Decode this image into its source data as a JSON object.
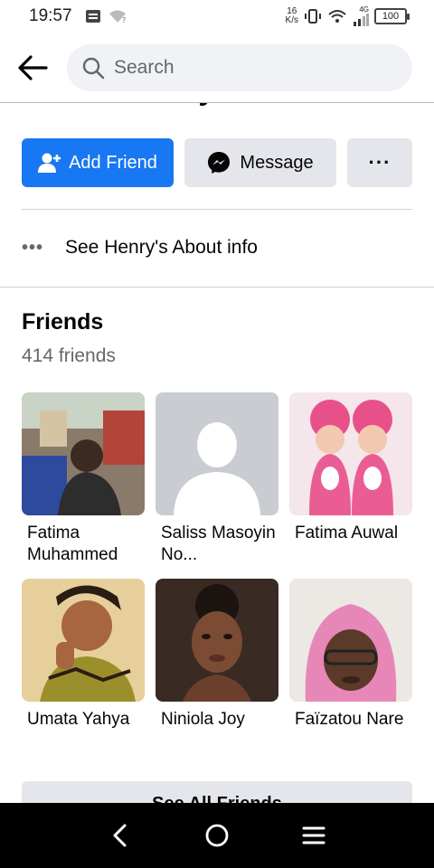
{
  "status_bar": {
    "time": "19:57",
    "net_speed_value": "16",
    "net_speed_unit": "K/s",
    "network_type": "4G",
    "battery": "100"
  },
  "top_nav": {
    "search_placeholder": "Search"
  },
  "profile": {
    "name_partial": "Henry Cavill"
  },
  "actions": {
    "add_friend_label": "Add Friend",
    "message_label": "Message",
    "more_label": "···"
  },
  "about": {
    "dots": "•••",
    "label": "See Henry's About info"
  },
  "friends": {
    "title": "Friends",
    "count": "414 friends",
    "list": [
      {
        "name": "Fatima Muhammed",
        "photo": "photo"
      },
      {
        "name": "Saliss Masoyin No...",
        "photo": "default-avatar"
      },
      {
        "name": "Fatima Auwal",
        "photo": "photo"
      },
      {
        "name": "Umata Yahya",
        "photo": "photo"
      },
      {
        "name": "Niniola Joy",
        "photo": "photo"
      },
      {
        "name": "Faïzatou Nare",
        "photo": "photo"
      }
    ],
    "see_all_label": "See All Friends"
  },
  "colors": {
    "primary": "#1877f2",
    "secondary_button": "#e4e6eb",
    "muted_text": "#65676b"
  }
}
